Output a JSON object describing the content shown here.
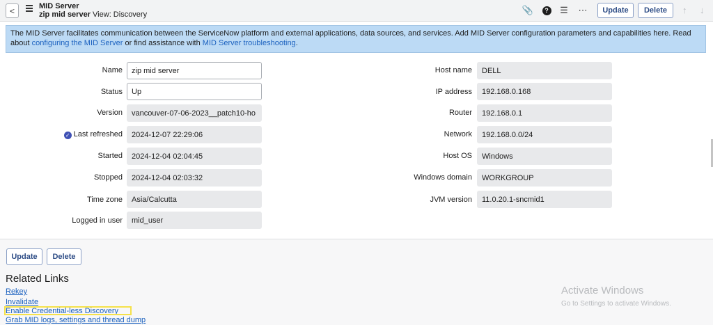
{
  "header": {
    "back_label": "<",
    "title": "MID Server",
    "record_name": "zip mid server",
    "view_label": "View: Discovery",
    "update_label": "Update",
    "delete_label": "Delete"
  },
  "banner": {
    "text_before": "The MID Server facilitates communication between the ServiceNow platform and external applications, data sources, and services. Add MID Server configuration parameters and capabilities here. Read about ",
    "link1": "configuring the MID Server",
    "text_middle": " or find assistance with ",
    "link2": "MID Server troubleshooting",
    "text_after": "."
  },
  "left_fields": [
    {
      "label": "Name",
      "value": "zip mid server"
    },
    {
      "label": "Status",
      "value": "Up"
    },
    {
      "label": "Version",
      "value": "vancouver-07-06-2023__patch10-ho"
    },
    {
      "label": "Last refreshed",
      "value": "2024-12-07 22:29:06"
    },
    {
      "label": "Started",
      "value": "2024-12-04 02:04:45"
    },
    {
      "label": "Stopped",
      "value": "2024-12-04 02:03:32"
    },
    {
      "label": "Time zone",
      "value": "Asia/Calcutta"
    },
    {
      "label": "Logged in user",
      "value": "mid_user"
    }
  ],
  "right_fields": [
    {
      "label": "Host name",
      "value": "DELL"
    },
    {
      "label": "IP address",
      "value": "192.168.0.168"
    },
    {
      "label": "Router",
      "value": "192.168.0.1"
    },
    {
      "label": "Network",
      "value": "192.168.0.0/24"
    },
    {
      "label": "Host OS",
      "value": "Windows"
    },
    {
      "label": "Windows domain",
      "value": "WORKGROUP"
    },
    {
      "label": "JVM version",
      "value": "11.0.20.1-sncmid1"
    }
  ],
  "bottom_buttons": {
    "update_label": "Update",
    "delete_label": "Delete"
  },
  "related_links": {
    "title": "Related Links",
    "items": [
      "Rekey",
      "Invalidate",
      "Enable Credential-less Discovery",
      "Grab MID logs, settings and thread dump"
    ]
  },
  "watermark": {
    "title": "Activate Windows",
    "subtitle": "Go to Settings to activate Windows."
  },
  "colors": {
    "banner_bg": "#bcdaf5",
    "link": "#1b61bf",
    "button_text": "#2e4d86",
    "highlight": "#f5e14a"
  }
}
